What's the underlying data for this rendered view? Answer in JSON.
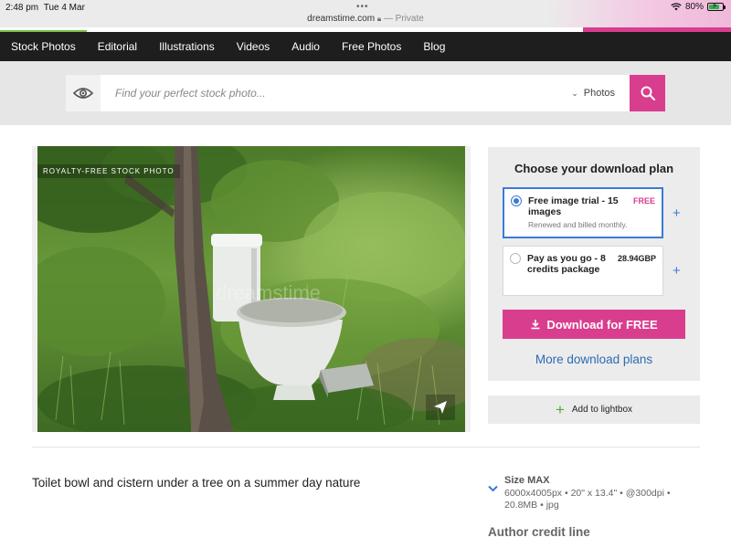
{
  "status_bar": {
    "time": "2:48 pm",
    "date": "Tue 4 Mar",
    "url": "dreamstime.com",
    "private_label": "— Private",
    "battery": "80%",
    "battery_level": 0.8
  },
  "nav": {
    "items": [
      "Stock Photos",
      "Editorial",
      "Illustrations",
      "Videos",
      "Audio",
      "Free Photos",
      "Blog"
    ],
    "active_index": 0
  },
  "search": {
    "placeholder": "Find your perfect stock photo...",
    "value": "",
    "type_label": "Photos"
  },
  "photo": {
    "badge": "ROYALTY-FREE STOCK PHOTO",
    "watermark": "dreamstime"
  },
  "download_panel": {
    "title": "Choose your download plan",
    "plans": [
      {
        "name": "Free image trial - 15 images",
        "price": "FREE",
        "subtitle": "Renewed and billed monthly.",
        "selected": true
      },
      {
        "name": "Pay as you go - 8 credits package",
        "price": "28.94GBP",
        "subtitle": "",
        "selected": false
      }
    ],
    "download_button": "Download for FREE",
    "more_plans": "More download plans"
  },
  "lightbox": {
    "label": "Add to lightbox"
  },
  "description": "Toilet bowl and cistern under a tree on a summer day nature",
  "size": {
    "title": "Size MAX",
    "detail": "6000x4005px • 20\" x 13.4\" • @300dpi • 20.8MB • jpg"
  },
  "author": {
    "label": "Author credit line"
  },
  "colors": {
    "accent_pink": "#d93d8e",
    "link_blue": "#2d6bb5",
    "nav_bg": "#1e1e1e",
    "active_green": "#7ac143"
  }
}
